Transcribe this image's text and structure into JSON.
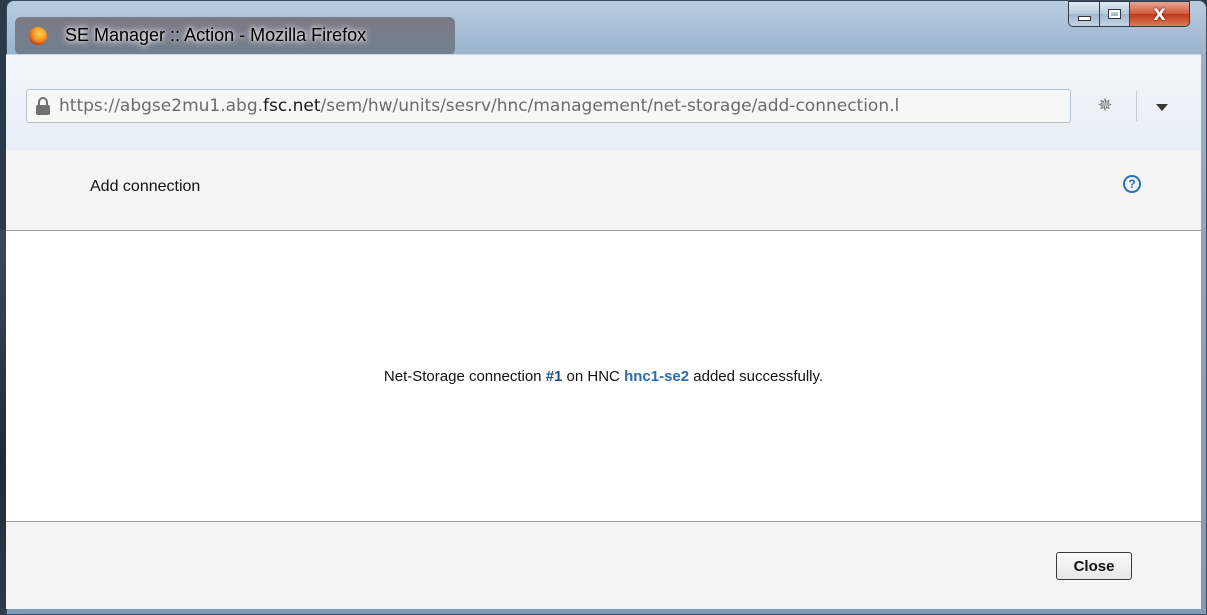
{
  "window": {
    "title": "SE Manager :: Action - Mozilla Firefox",
    "controls": {
      "close_glyph": "X"
    }
  },
  "navbar": {
    "url_prefix": "https://abgse2mu1.abg.",
    "url_domain": "fsc.net",
    "url_suffix": "/sem/hw/units/sesrv/hnc/management/net-storage/add-connection.l"
  },
  "dialog": {
    "title": "Add connection",
    "help_glyph": "?",
    "message": {
      "part1": "Net-Storage connection ",
      "connection_number": "#1",
      "part2": " on HNC ",
      "hnc_link": "hnc1-se2",
      "part3": " added successfully."
    },
    "close_label": "Close"
  }
}
